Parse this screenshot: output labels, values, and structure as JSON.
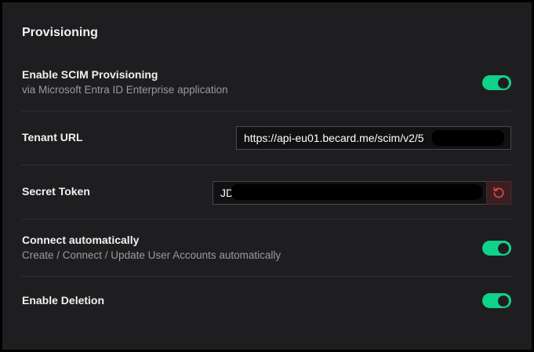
{
  "section": {
    "title": "Provisioning"
  },
  "scim": {
    "label": "Enable SCIM Provisioning",
    "description": "via Microsoft Entra ID Enterprise application",
    "enabled": true
  },
  "tenant_url": {
    "label": "Tenant URL",
    "value": "https://api-eu01.becard.me/scim/v2/5"
  },
  "secret_token": {
    "label": "Secret Token",
    "value": "JD"
  },
  "connect_auto": {
    "label": "Connect automatically",
    "description": "Create / Connect / Update User Accounts automatically",
    "enabled": true
  },
  "deletion": {
    "label": "Enable Deletion",
    "enabled": true
  },
  "colors": {
    "accent": "#10d28a",
    "panel_bg": "#1e1e20",
    "danger": "#e0484d"
  },
  "icons": {
    "reset": "refresh-icon"
  }
}
